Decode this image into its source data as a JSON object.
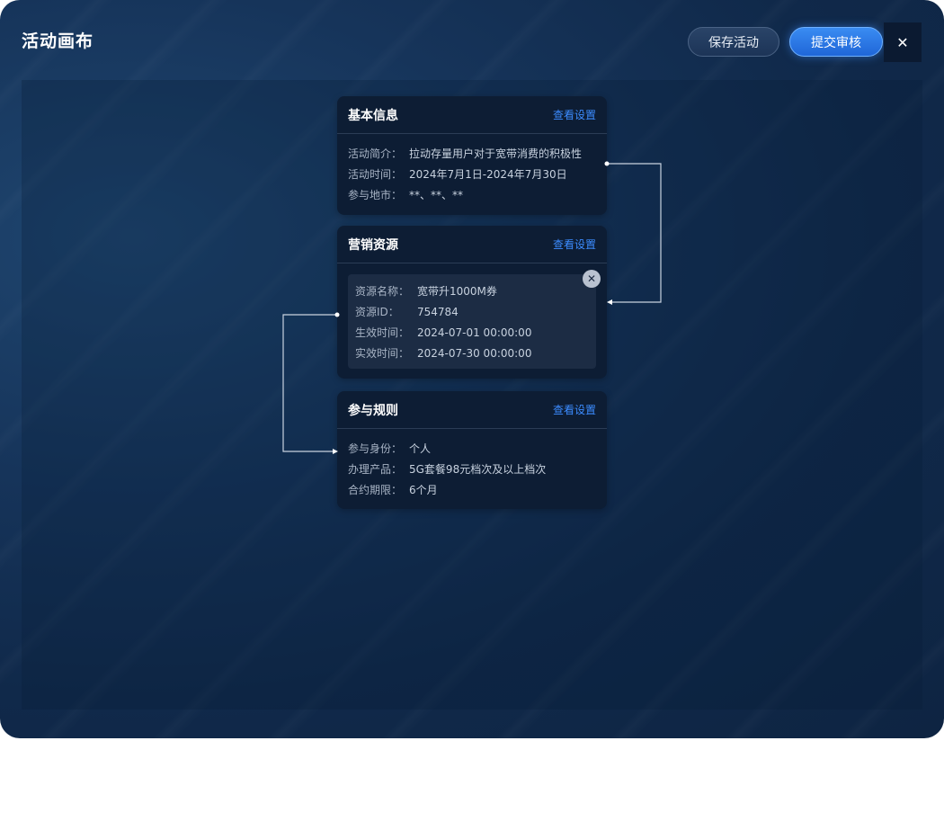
{
  "header": {
    "title": "活动画布",
    "save_label": "保存活动",
    "submit_label": "提交审核",
    "close_glyph": "✕"
  },
  "cards": {
    "basic": {
      "title": "基本信息",
      "link": "查看设置",
      "rows": [
        {
          "label": "活动简介：",
          "value": "拉动存量用户对于宽带消费的积极性"
        },
        {
          "label": "活动时间：",
          "value": "2024年7月1日-2024年7月30日"
        },
        {
          "label": "参与地市：",
          "value": "**、**、**"
        }
      ]
    },
    "resource": {
      "title": "营销资源",
      "link": "查看设置",
      "remove_glyph": "✕",
      "rows": [
        {
          "label": "资源名称：",
          "value": "宽带升1000M券"
        },
        {
          "label": "资源ID：",
          "value": "754784"
        },
        {
          "label": "生效时间：",
          "value": "2024-07-01 00:00:00"
        },
        {
          "label": "实效时间：",
          "value": "2024-07-30 00:00:00"
        }
      ]
    },
    "rules": {
      "title": "参与规则",
      "link": "查看设置",
      "rows": [
        {
          "label": "参与身份：",
          "value": "个人"
        },
        {
          "label": "办理产品：",
          "value": "5G套餐98元档次及以上档次"
        },
        {
          "label": "合约期限：",
          "value": "6个月"
        }
      ]
    }
  },
  "colors": {
    "accent": "#3c8cff",
    "card_bg": "#0d1d34",
    "panel_bg": "#14335a"
  },
  "icons": [
    "close-icon",
    "remove-resource-icon"
  ]
}
